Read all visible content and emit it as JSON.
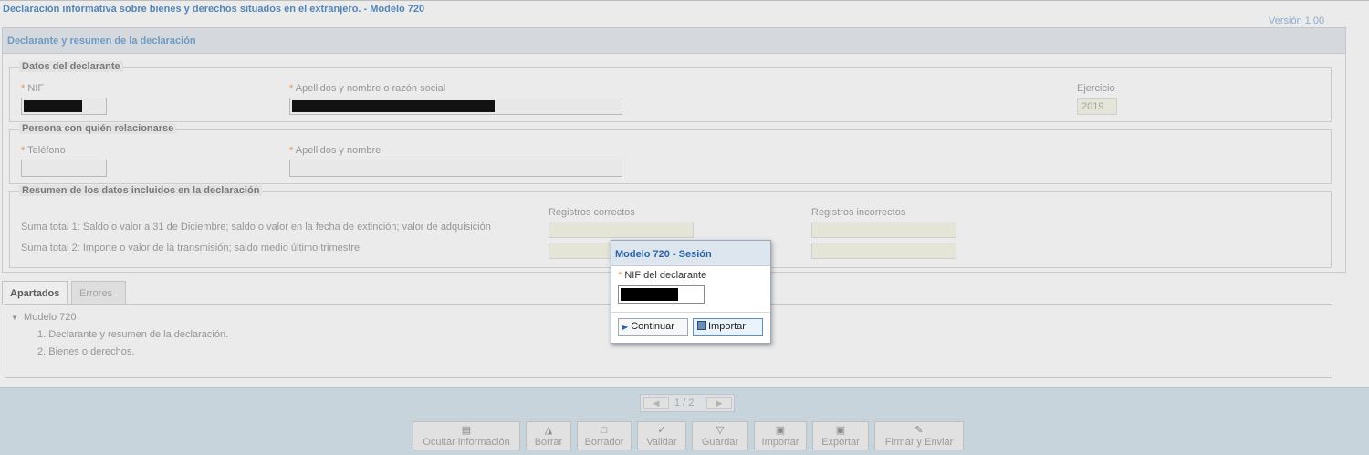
{
  "app": {
    "title": "Declaración informativa sobre bienes y derechos situados en el extranjero. - Modelo 720",
    "version": "Versión 1.00"
  },
  "section": {
    "header": "Declarante y resumen de la declaración"
  },
  "declarante": {
    "legend": "Datos del declarante",
    "nif_label": "NIF",
    "nombre_label": "Apellidos y nombre o razón social",
    "ejercicio_label": "Ejercicio",
    "ejercicio_value": "2019"
  },
  "contacto": {
    "legend": "Persona con quién relacionarse",
    "telefono_label": "Teléfono",
    "nombre_label": "Apellidos y nombre"
  },
  "resumen": {
    "legend": "Resumen de los datos incluidos en la declaración",
    "col_correctos": "Registros correctos",
    "col_incorrectos": "Registros incorrectos",
    "row1": "Suma total 1: Saldo o valor a 31 de Diciembre; saldo o valor en la fecha de extinción; valor de adquisición",
    "row2": "Suma total 2: Importe o valor de la transmisión; saldo medio último trimestre"
  },
  "required_mark": "*",
  "tabs": {
    "apartados": "Apartados",
    "errores": "Errores"
  },
  "tree": {
    "root": "Modelo 720",
    "items": [
      "1. Declarante y resumen de la declaración.",
      "2. Bienes o derechos."
    ]
  },
  "pager": {
    "info": "1 / 2"
  },
  "toolbar": {
    "ocultar": "Ocultar información",
    "borrar": "Borrar",
    "borrador": "Borrador",
    "validar": "Validar",
    "guardar": "Guardar",
    "importar": "Importar",
    "exportar": "Exportar",
    "firmar": "Firmar y Enviar"
  },
  "modal": {
    "title": "Modelo 720 - Sesión",
    "nif_label": "NIF del declarante",
    "continuar": "Continuar",
    "importar": "Importar"
  },
  "colors": {
    "accent": "#4a88c2",
    "required": "#e5a24d",
    "footer_bg": "#d3e2ec"
  }
}
